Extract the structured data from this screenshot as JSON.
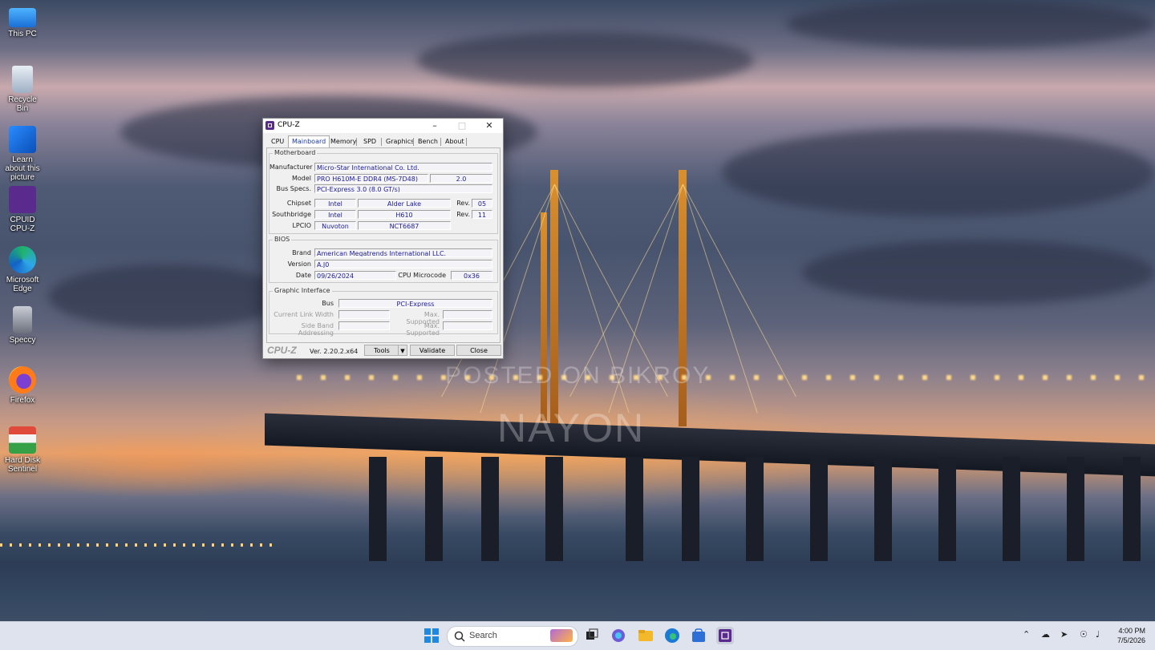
{
  "desktop": {
    "icons": [
      {
        "label": "This PC"
      },
      {
        "label": "Recycle Bin"
      },
      {
        "label": "Learn about this picture"
      },
      {
        "label": "CPUID CPU-Z"
      },
      {
        "label": "Microsoft Edge"
      },
      {
        "label": "Speccy"
      },
      {
        "label": "Firefox"
      },
      {
        "label": "Hard Disk Sentinel"
      }
    ],
    "watermark_line1": "POSTED ON BIKROY",
    "watermark_line2": "NAYON"
  },
  "window": {
    "title": "CPU-Z",
    "tabs": [
      "CPU",
      "Mainboard",
      "Memory",
      "SPD",
      "Graphics",
      "Bench",
      "About"
    ],
    "active_tab": "Mainboard",
    "motherboard": {
      "group_label": "Motherboard",
      "manufacturer_label": "Manufacturer",
      "manufacturer": "Micro-Star International Co. Ltd.",
      "model_label": "Model",
      "model": "PRO H610M-E DDR4 (MS-7D48)",
      "model_rev": "2.0",
      "bus_label": "Bus Specs.",
      "bus": "PCI-Express 3.0 (8.0 GT/s)",
      "chipset_label": "Chipset",
      "chipset_vendor": "Intel",
      "chipset_name": "Alder Lake",
      "chipset_rev_label": "Rev.",
      "chipset_rev": "05",
      "southbridge_label": "Southbridge",
      "southbridge_vendor": "Intel",
      "southbridge_name": "H610",
      "southbridge_rev_label": "Rev.",
      "southbridge_rev": "11",
      "lpcio_label": "LPCIO",
      "lpcio_vendor": "Nuvoton",
      "lpcio_name": "NCT6687"
    },
    "bios": {
      "group_label": "BIOS",
      "brand_label": "Brand",
      "brand": "American Megatrends International LLC.",
      "version_label": "Version",
      "version": "A.J0",
      "date_label": "Date",
      "date": "09/26/2024",
      "microcode_label": "CPU Microcode",
      "microcode": "0x36"
    },
    "graphic": {
      "group_label": "Graphic Interface",
      "bus_label": "Bus",
      "bus": "PCI-Express",
      "link_width_label": "Current Link Width",
      "link_width": "",
      "max_supported_label": "Max. Supported",
      "max_supported_1": "",
      "side_band_label": "Side Band Addressing",
      "side_band": "",
      "max_supported_2": ""
    },
    "footer": {
      "logo": "CPU-Z",
      "version": "Ver. 2.20.2.x64",
      "tools_label": "Tools",
      "validate_label": "Validate",
      "close_label": "Close"
    }
  },
  "taskbar": {
    "search_placeholder": "Search",
    "time": "4:00 PM",
    "date": "7/5/2026"
  }
}
